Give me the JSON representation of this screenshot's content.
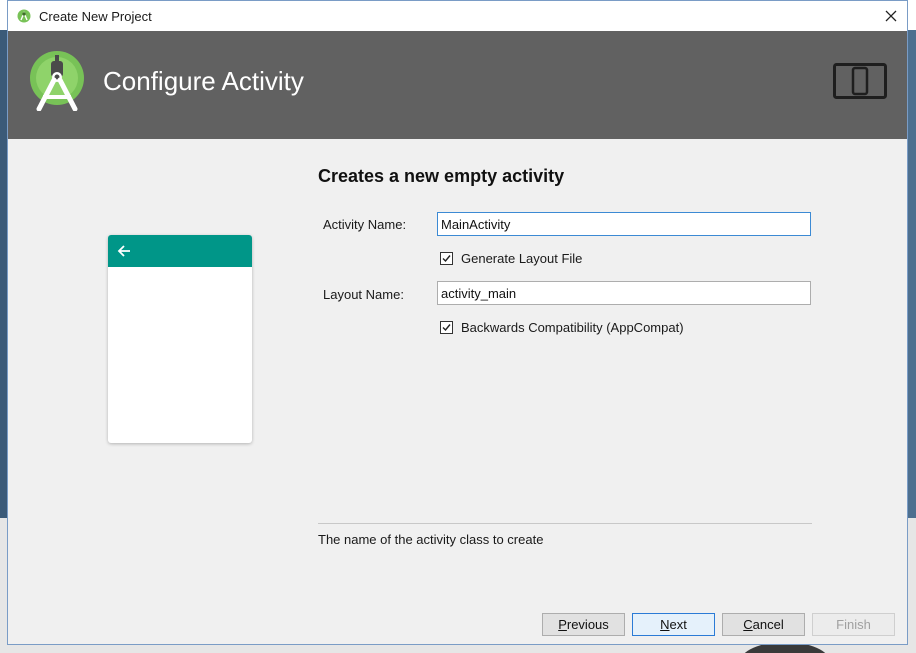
{
  "window": {
    "title": "Create New Project"
  },
  "header": {
    "title": "Configure Activity"
  },
  "form": {
    "section_title": "Creates a new empty activity",
    "activity_name_label": "Activity Name:",
    "activity_name_value": "MainActivity",
    "generate_layout_label": "Generate Layout File",
    "generate_layout_checked": true,
    "layout_name_label": "Layout Name:",
    "layout_name_value": "activity_main",
    "backwards_compat_label": "Backwards Compatibility (AppCompat)",
    "backwards_compat_checked": true
  },
  "help": {
    "text": "The name of the activity class to create"
  },
  "buttons": {
    "previous_mnemonic": "P",
    "previous_rest": "revious",
    "next_mnemonic": "N",
    "next_rest": "ext",
    "cancel_mnemonic": "C",
    "cancel_rest": "ancel",
    "finish": "Finish"
  },
  "colors": {
    "header_bg": "#616161",
    "preview_bar": "#009688",
    "android_green": "#78c257"
  },
  "icons": {
    "app": "android-studio-icon",
    "close": "close-icon",
    "device": "device-form-factor-icon",
    "back": "back-arrow-icon"
  }
}
